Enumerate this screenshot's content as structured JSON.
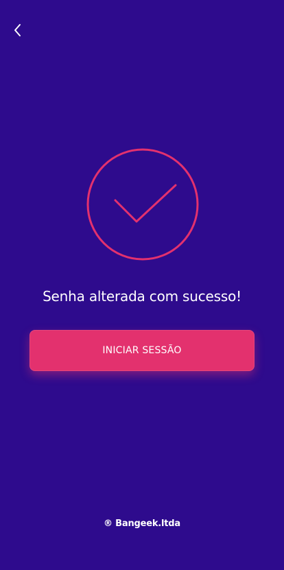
{
  "header": {
    "back_icon": "chevron-left-icon"
  },
  "success": {
    "icon": "check-circle-icon",
    "message": "Senha alterada com sucesso!"
  },
  "actions": {
    "start_session_label": "INICIAR SESSÃO"
  },
  "footer": {
    "brand": "® Bangeek.ltda"
  },
  "colors": {
    "background": "#2e0b8d",
    "accent": "#e3316e",
    "text": "#ffffff"
  }
}
